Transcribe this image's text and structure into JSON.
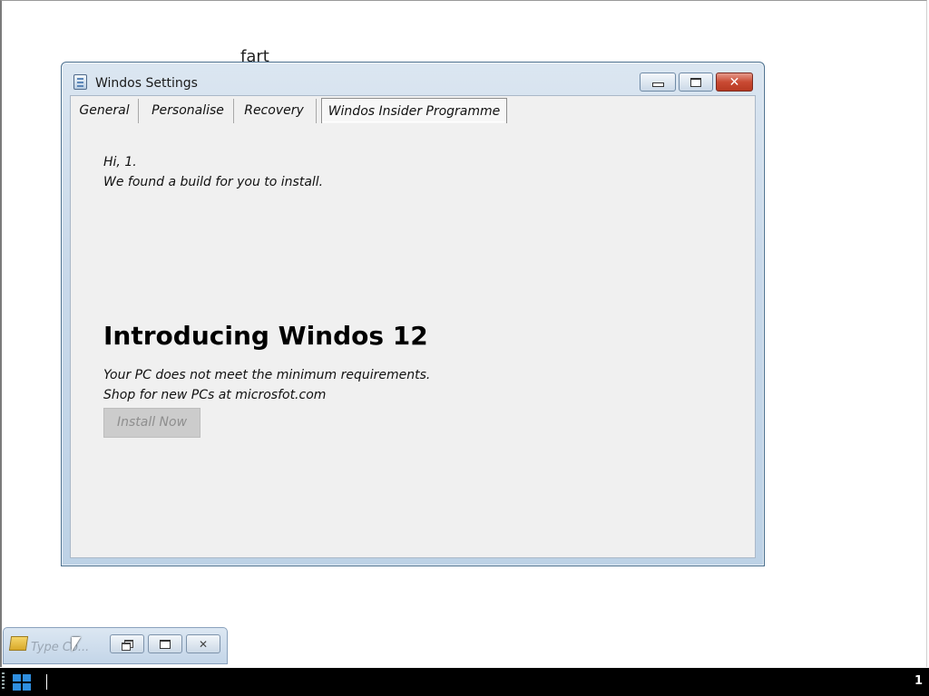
{
  "desktop": {
    "background_text": "fart"
  },
  "window": {
    "title": "Windos Settings",
    "controls": {
      "minimize": "minimize",
      "maximize": "maximize",
      "close": "✕"
    },
    "tabs": [
      {
        "label": "General",
        "active": false
      },
      {
        "label": "Personalise",
        "active": false
      },
      {
        "label": "Recovery",
        "active": false
      },
      {
        "label": "Windos Insider Programme",
        "active": true
      }
    ],
    "content": {
      "greeting_line1": "Hi, 1.",
      "greeting_line2": "We found a build for you to install.",
      "headline": "Introducing Windos 12",
      "requirement_line1": "Your PC does not meet the minimum requirements.",
      "requirement_line2": "Shop for new PCs at microsfot.com",
      "install_button": "Install Now",
      "install_button_enabled": false
    }
  },
  "minimized_window": {
    "title": "Type Co..."
  },
  "taskbar": {
    "tray_text": "1"
  },
  "colors": {
    "window_frame": "#c9d9ea",
    "close_button": "#c94a33",
    "taskbar": "#000000",
    "start_logo": "#2f8fe0"
  }
}
